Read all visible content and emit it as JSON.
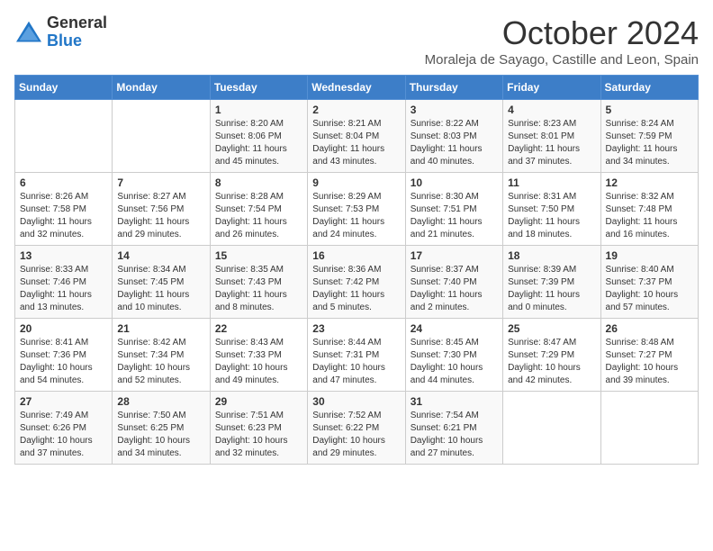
{
  "logo": {
    "general": "General",
    "blue": "Blue"
  },
  "title": "October 2024",
  "subtitle": "Moraleja de Sayago, Castille and Leon, Spain",
  "weekdays": [
    "Sunday",
    "Monday",
    "Tuesday",
    "Wednesday",
    "Thursday",
    "Friday",
    "Saturday"
  ],
  "weeks": [
    [
      {
        "day": "",
        "sunrise": "",
        "sunset": "",
        "daylight": ""
      },
      {
        "day": "",
        "sunrise": "",
        "sunset": "",
        "daylight": ""
      },
      {
        "day": "1",
        "sunrise": "Sunrise: 8:20 AM",
        "sunset": "Sunset: 8:06 PM",
        "daylight": "Daylight: 11 hours and 45 minutes."
      },
      {
        "day": "2",
        "sunrise": "Sunrise: 8:21 AM",
        "sunset": "Sunset: 8:04 PM",
        "daylight": "Daylight: 11 hours and 43 minutes."
      },
      {
        "day": "3",
        "sunrise": "Sunrise: 8:22 AM",
        "sunset": "Sunset: 8:03 PM",
        "daylight": "Daylight: 11 hours and 40 minutes."
      },
      {
        "day": "4",
        "sunrise": "Sunrise: 8:23 AM",
        "sunset": "Sunset: 8:01 PM",
        "daylight": "Daylight: 11 hours and 37 minutes."
      },
      {
        "day": "5",
        "sunrise": "Sunrise: 8:24 AM",
        "sunset": "Sunset: 7:59 PM",
        "daylight": "Daylight: 11 hours and 34 minutes."
      }
    ],
    [
      {
        "day": "6",
        "sunrise": "Sunrise: 8:26 AM",
        "sunset": "Sunset: 7:58 PM",
        "daylight": "Daylight: 11 hours and 32 minutes."
      },
      {
        "day": "7",
        "sunrise": "Sunrise: 8:27 AM",
        "sunset": "Sunset: 7:56 PM",
        "daylight": "Daylight: 11 hours and 29 minutes."
      },
      {
        "day": "8",
        "sunrise": "Sunrise: 8:28 AM",
        "sunset": "Sunset: 7:54 PM",
        "daylight": "Daylight: 11 hours and 26 minutes."
      },
      {
        "day": "9",
        "sunrise": "Sunrise: 8:29 AM",
        "sunset": "Sunset: 7:53 PM",
        "daylight": "Daylight: 11 hours and 24 minutes."
      },
      {
        "day": "10",
        "sunrise": "Sunrise: 8:30 AM",
        "sunset": "Sunset: 7:51 PM",
        "daylight": "Daylight: 11 hours and 21 minutes."
      },
      {
        "day": "11",
        "sunrise": "Sunrise: 8:31 AM",
        "sunset": "Sunset: 7:50 PM",
        "daylight": "Daylight: 11 hours and 18 minutes."
      },
      {
        "day": "12",
        "sunrise": "Sunrise: 8:32 AM",
        "sunset": "Sunset: 7:48 PM",
        "daylight": "Daylight: 11 hours and 16 minutes."
      }
    ],
    [
      {
        "day": "13",
        "sunrise": "Sunrise: 8:33 AM",
        "sunset": "Sunset: 7:46 PM",
        "daylight": "Daylight: 11 hours and 13 minutes."
      },
      {
        "day": "14",
        "sunrise": "Sunrise: 8:34 AM",
        "sunset": "Sunset: 7:45 PM",
        "daylight": "Daylight: 11 hours and 10 minutes."
      },
      {
        "day": "15",
        "sunrise": "Sunrise: 8:35 AM",
        "sunset": "Sunset: 7:43 PM",
        "daylight": "Daylight: 11 hours and 8 minutes."
      },
      {
        "day": "16",
        "sunrise": "Sunrise: 8:36 AM",
        "sunset": "Sunset: 7:42 PM",
        "daylight": "Daylight: 11 hours and 5 minutes."
      },
      {
        "day": "17",
        "sunrise": "Sunrise: 8:37 AM",
        "sunset": "Sunset: 7:40 PM",
        "daylight": "Daylight: 11 hours and 2 minutes."
      },
      {
        "day": "18",
        "sunrise": "Sunrise: 8:39 AM",
        "sunset": "Sunset: 7:39 PM",
        "daylight": "Daylight: 11 hours and 0 minutes."
      },
      {
        "day": "19",
        "sunrise": "Sunrise: 8:40 AM",
        "sunset": "Sunset: 7:37 PM",
        "daylight": "Daylight: 10 hours and 57 minutes."
      }
    ],
    [
      {
        "day": "20",
        "sunrise": "Sunrise: 8:41 AM",
        "sunset": "Sunset: 7:36 PM",
        "daylight": "Daylight: 10 hours and 54 minutes."
      },
      {
        "day": "21",
        "sunrise": "Sunrise: 8:42 AM",
        "sunset": "Sunset: 7:34 PM",
        "daylight": "Daylight: 10 hours and 52 minutes."
      },
      {
        "day": "22",
        "sunrise": "Sunrise: 8:43 AM",
        "sunset": "Sunset: 7:33 PM",
        "daylight": "Daylight: 10 hours and 49 minutes."
      },
      {
        "day": "23",
        "sunrise": "Sunrise: 8:44 AM",
        "sunset": "Sunset: 7:31 PM",
        "daylight": "Daylight: 10 hours and 47 minutes."
      },
      {
        "day": "24",
        "sunrise": "Sunrise: 8:45 AM",
        "sunset": "Sunset: 7:30 PM",
        "daylight": "Daylight: 10 hours and 44 minutes."
      },
      {
        "day": "25",
        "sunrise": "Sunrise: 8:47 AM",
        "sunset": "Sunset: 7:29 PM",
        "daylight": "Daylight: 10 hours and 42 minutes."
      },
      {
        "day": "26",
        "sunrise": "Sunrise: 8:48 AM",
        "sunset": "Sunset: 7:27 PM",
        "daylight": "Daylight: 10 hours and 39 minutes."
      }
    ],
    [
      {
        "day": "27",
        "sunrise": "Sunrise: 7:49 AM",
        "sunset": "Sunset: 6:26 PM",
        "daylight": "Daylight: 10 hours and 37 minutes."
      },
      {
        "day": "28",
        "sunrise": "Sunrise: 7:50 AM",
        "sunset": "Sunset: 6:25 PM",
        "daylight": "Daylight: 10 hours and 34 minutes."
      },
      {
        "day": "29",
        "sunrise": "Sunrise: 7:51 AM",
        "sunset": "Sunset: 6:23 PM",
        "daylight": "Daylight: 10 hours and 32 minutes."
      },
      {
        "day": "30",
        "sunrise": "Sunrise: 7:52 AM",
        "sunset": "Sunset: 6:22 PM",
        "daylight": "Daylight: 10 hours and 29 minutes."
      },
      {
        "day": "31",
        "sunrise": "Sunrise: 7:54 AM",
        "sunset": "Sunset: 6:21 PM",
        "daylight": "Daylight: 10 hours and 27 minutes."
      },
      {
        "day": "",
        "sunrise": "",
        "sunset": "",
        "daylight": ""
      },
      {
        "day": "",
        "sunrise": "",
        "sunset": "",
        "daylight": ""
      }
    ]
  ]
}
